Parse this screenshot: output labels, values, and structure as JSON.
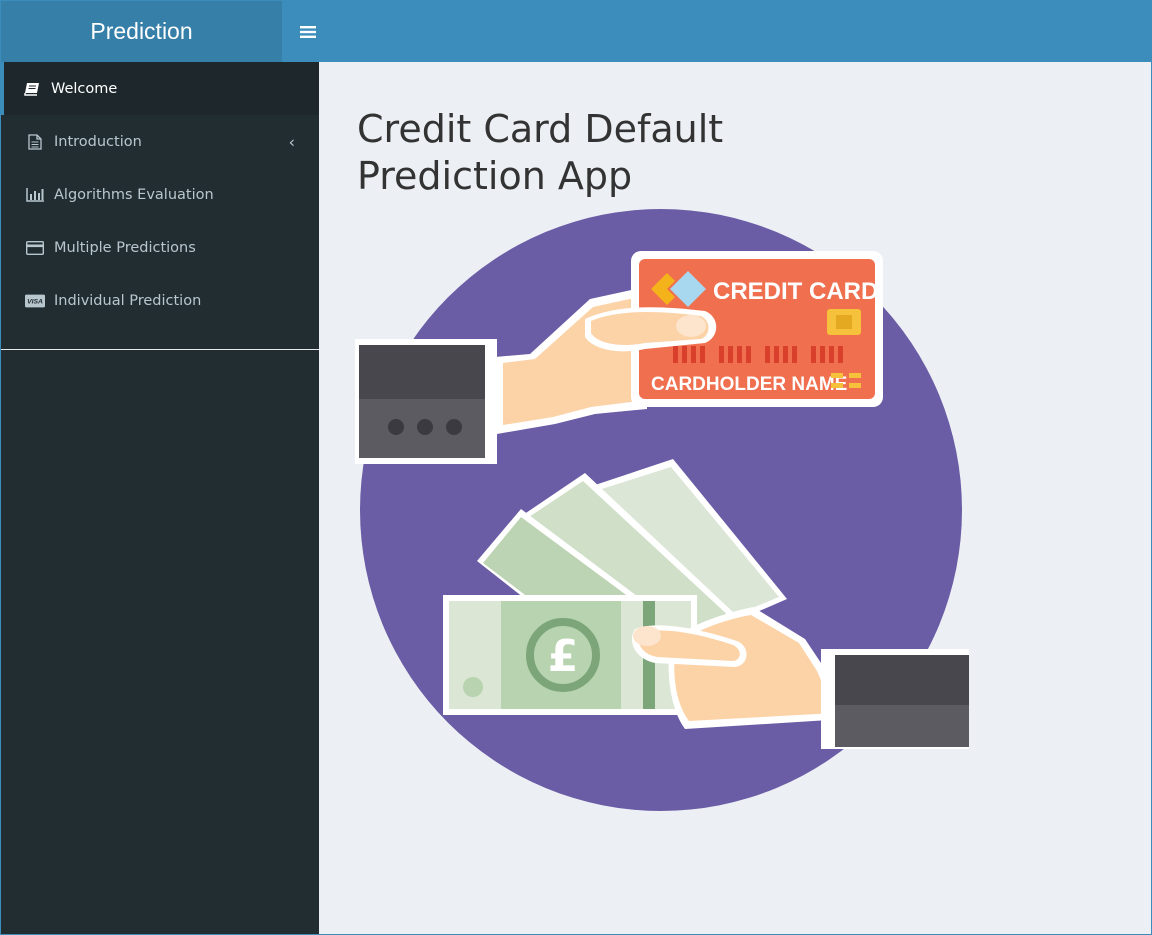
{
  "header": {
    "brand": "Prediction",
    "menu_toggle_icon": "hamburger-icon"
  },
  "sidebar": {
    "items": [
      {
        "label": "Welcome",
        "icon": "book-icon",
        "active": true
      },
      {
        "label": "Introduction",
        "icon": "document-icon",
        "has_submenu": true
      },
      {
        "label": "Algorithms Evaluation",
        "icon": "bar-chart-icon"
      },
      {
        "label": "Multiple Predictions",
        "icon": "credit-card-icon"
      },
      {
        "label": "Individual Prediction",
        "icon": "visa-card-icon"
      }
    ]
  },
  "main": {
    "title": "Credit Card Default Prediction App",
    "illustration": {
      "card_title": "CREDIT CARD",
      "card_holder": "CARDHOLDER NAME",
      "currency_symbol": "£"
    }
  },
  "colors": {
    "header": "#3c8dbc",
    "logo_bg": "#367fa9",
    "sidebar": "#222d32",
    "sidebar_active": "#1e282c",
    "content_bg": "#ecf0f5",
    "circle": "#6a5ca5",
    "card": "#ef6f4f"
  }
}
